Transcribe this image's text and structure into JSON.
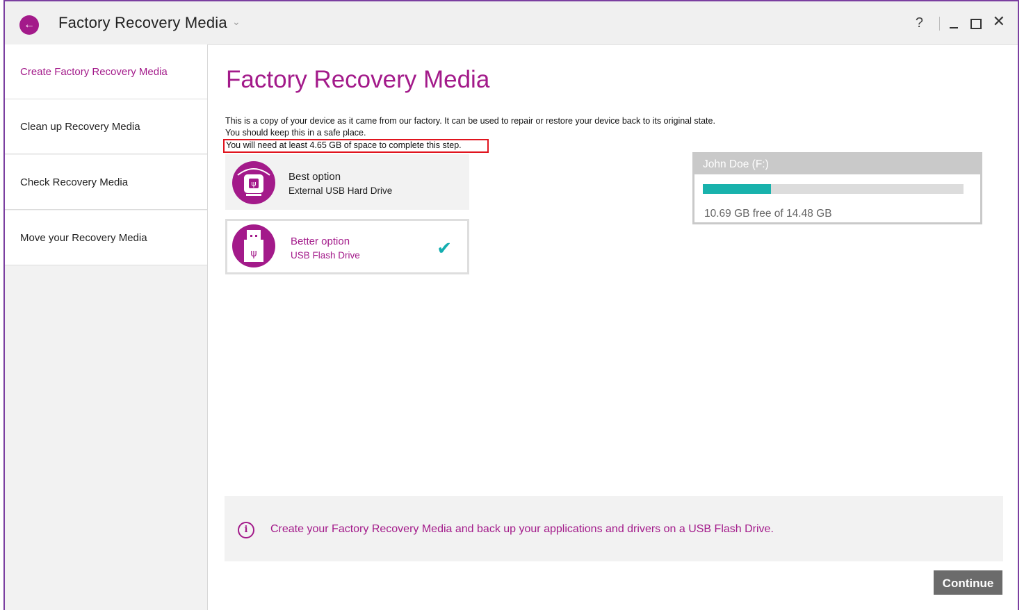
{
  "window": {
    "title": "Factory Recovery Media",
    "controls": {
      "help": "?",
      "minimize_icon": "minimize-icon",
      "maximize_icon": "maximize-icon",
      "close": "✕"
    }
  },
  "sidebar": {
    "items": [
      {
        "label": "Create Factory Recovery Media",
        "active": true
      },
      {
        "label": "Clean up Recovery Media",
        "active": false
      },
      {
        "label": "Check Recovery Media",
        "active": false
      },
      {
        "label": "Move your Recovery Media",
        "active": false
      }
    ]
  },
  "main": {
    "title": "Factory Recovery Media",
    "description_line1": "This is a copy of your device as it came from our factory. It can be used to repair or restore your device back to its original state.",
    "description_line2": "You should keep this in a safe place.",
    "space_notice": "You will need at least 4.65 GB of space to complete this step.",
    "options": [
      {
        "title": "Best option",
        "subtitle": "External USB Hard Drive",
        "icon": "hard-drive-icon",
        "selected": false
      },
      {
        "title": "Better option",
        "subtitle": "USB Flash Drive",
        "icon": "usb-flash-icon",
        "selected": true
      }
    ]
  },
  "drive": {
    "name": "John Doe (F:)",
    "used_fraction": 0.262,
    "free_text": "10.69 GB free of 14.48 GB"
  },
  "info": {
    "text": "Create your Factory Recovery Media and back up your applications and drivers on a USB Flash Drive."
  },
  "actions": {
    "continue_label": "Continue"
  },
  "colors": {
    "accent": "#a31a8a",
    "teal": "#18b2ac",
    "button": "#6b6b6b"
  }
}
